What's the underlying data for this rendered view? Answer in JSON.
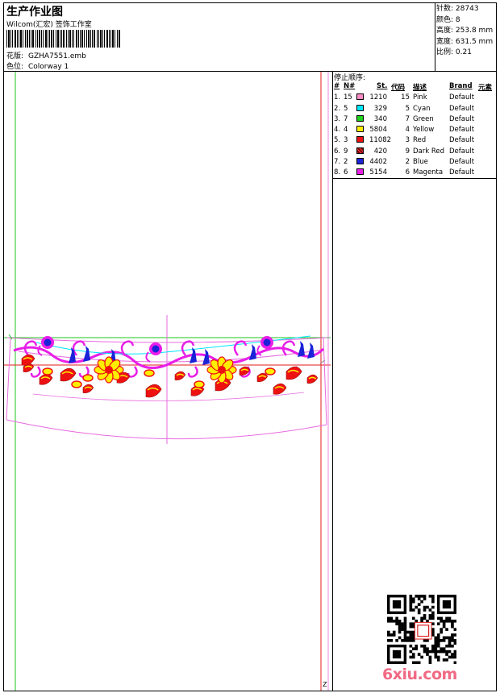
{
  "header": {
    "title": "生产作业图",
    "studio": "Wilcom(汇宏) 签饰工作室",
    "design_label": "花版:",
    "design_value": "GZHA7551.emb",
    "colorway_label": "色位:",
    "colorway_value": "Colorway 1"
  },
  "stats": [
    {
      "label": "针数:",
      "value": "28743"
    },
    {
      "label": "颜色:",
      "value": "8"
    },
    {
      "label": "高度:",
      "value": "253.8 mm"
    },
    {
      "label": "宽度:",
      "value": "631.5 mm"
    },
    {
      "label": "比例:",
      "value": "0.21"
    }
  ],
  "color_table": {
    "title": "停止顺序:",
    "headers": {
      "idx": "#",
      "needle": "N#",
      "stitches": "St.",
      "code": "代码",
      "desc": "描述",
      "brand": "Brand",
      "element": "元素"
    },
    "rows": [
      {
        "idx": "1.",
        "needle": "15",
        "swatch": "#ff8cc6",
        "stitches": "1210",
        "code": "15",
        "desc": "Pink",
        "brand": "Default"
      },
      {
        "idx": "2.",
        "needle": "5",
        "swatch": "#00e5ff",
        "stitches": "329",
        "code": "5",
        "desc": "Cyan",
        "brand": "Default"
      },
      {
        "idx": "3.",
        "needle": "7",
        "swatch": "#1ed41e",
        "stitches": "340",
        "code": "7",
        "desc": "Green",
        "brand": "Default"
      },
      {
        "idx": "4.",
        "needle": "4",
        "swatch": "#ffee00",
        "stitches": "5804",
        "code": "4",
        "desc": "Yellow",
        "brand": "Default"
      },
      {
        "idx": "5.",
        "needle": "3",
        "swatch": "#ee1111",
        "stitches": "11082",
        "code": "3",
        "desc": "Red",
        "brand": "Default"
      },
      {
        "idx": "6.",
        "needle": "9",
        "swatch": "#991111",
        "stitches": "420",
        "code": "9",
        "desc": "Dark Red",
        "brand": "Default"
      },
      {
        "idx": "7.",
        "needle": "2",
        "swatch": "#1a23d8",
        "stitches": "4402",
        "code": "2",
        "desc": "Blue",
        "brand": "Default"
      },
      {
        "idx": "8.",
        "needle": "6",
        "swatch": "#e81ee8",
        "stitches": "5154",
        "code": "6",
        "desc": "Magenta",
        "brand": "Default"
      }
    ]
  },
  "watermark": "6xiu.com",
  "corner_mark": "Z"
}
